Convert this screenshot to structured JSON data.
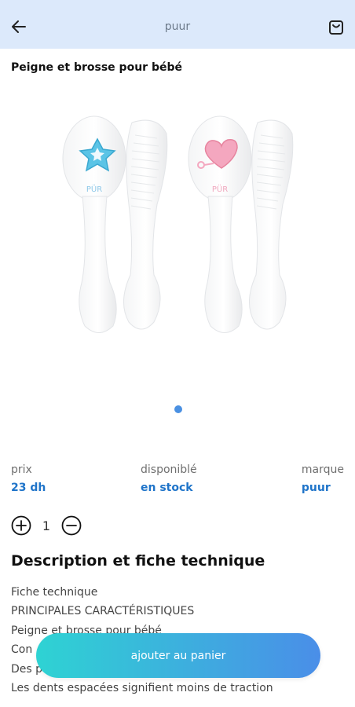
{
  "appbar": {
    "title": "puur"
  },
  "product": {
    "title": "Peigne et brosse pour bébé",
    "brand_mark": "PÜR"
  },
  "info": {
    "price_label": "prix",
    "price_value": "23 dh",
    "availability_label": "disponiblé",
    "availability_value": "en stock",
    "brand_label": "marque",
    "brand_value": "puur"
  },
  "quantity": {
    "value": "1"
  },
  "description": {
    "title": "Description et fiche technique",
    "lines": [
      "Fiche technique",
      "PRINCIPALES CARACTÉRISTIQUES",
      "Peigne et brosse pour bébé",
      "Con",
      "Des p",
      "Les dents espacées signifient moins de traction"
    ]
  },
  "cta": {
    "label": "ajouter au panier"
  },
  "colors": {
    "appbar": "#dce9fb",
    "accent": "#1f74c9",
    "gradient_start": "#2ed3d3",
    "gradient_end": "#4a8ee8"
  },
  "icons": [
    "back-arrow-icon",
    "shopping-bag-icon",
    "plus-circle-icon",
    "minus-circle-icon"
  ]
}
